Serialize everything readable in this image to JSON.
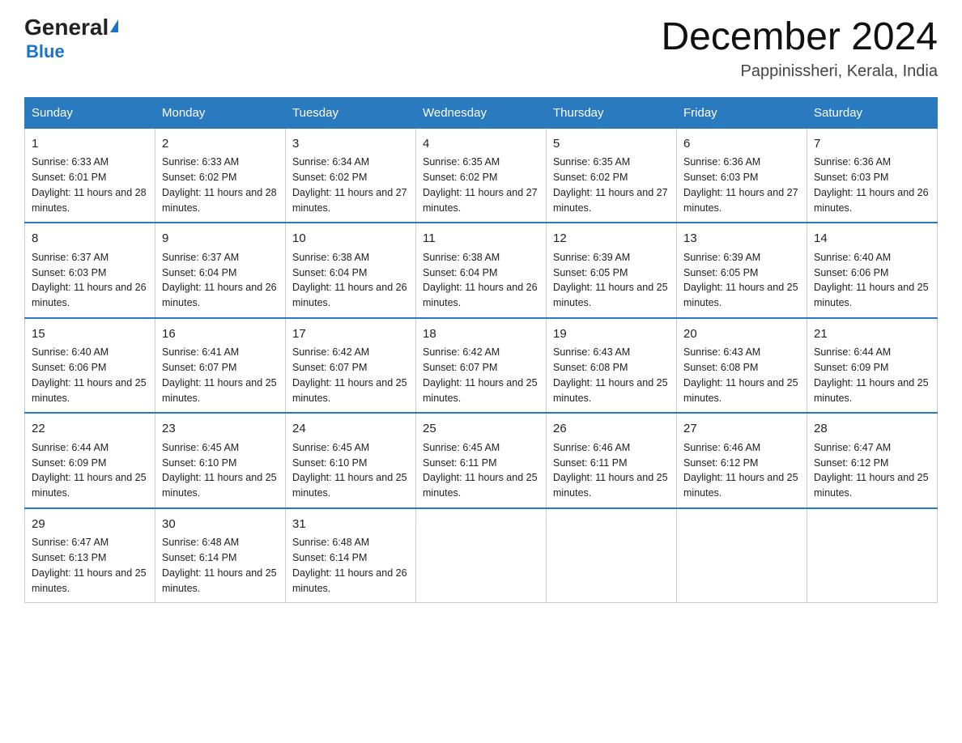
{
  "logo": {
    "general": "General",
    "blue": "Blue",
    "triangle_label": "logo-triangle"
  },
  "header": {
    "title": "December 2024",
    "subtitle": "Pappinissheri, Kerala, India"
  },
  "weekdays": [
    "Sunday",
    "Monday",
    "Tuesday",
    "Wednesday",
    "Thursday",
    "Friday",
    "Saturday"
  ],
  "weeks": [
    [
      {
        "day": "1",
        "sunrise": "6:33 AM",
        "sunset": "6:01 PM",
        "daylight": "11 hours and 28 minutes."
      },
      {
        "day": "2",
        "sunrise": "6:33 AM",
        "sunset": "6:02 PM",
        "daylight": "11 hours and 28 minutes."
      },
      {
        "day": "3",
        "sunrise": "6:34 AM",
        "sunset": "6:02 PM",
        "daylight": "11 hours and 27 minutes."
      },
      {
        "day": "4",
        "sunrise": "6:35 AM",
        "sunset": "6:02 PM",
        "daylight": "11 hours and 27 minutes."
      },
      {
        "day": "5",
        "sunrise": "6:35 AM",
        "sunset": "6:02 PM",
        "daylight": "11 hours and 27 minutes."
      },
      {
        "day": "6",
        "sunrise": "6:36 AM",
        "sunset": "6:03 PM",
        "daylight": "11 hours and 27 minutes."
      },
      {
        "day": "7",
        "sunrise": "6:36 AM",
        "sunset": "6:03 PM",
        "daylight": "11 hours and 26 minutes."
      }
    ],
    [
      {
        "day": "8",
        "sunrise": "6:37 AM",
        "sunset": "6:03 PM",
        "daylight": "11 hours and 26 minutes."
      },
      {
        "day": "9",
        "sunrise": "6:37 AM",
        "sunset": "6:04 PM",
        "daylight": "11 hours and 26 minutes."
      },
      {
        "day": "10",
        "sunrise": "6:38 AM",
        "sunset": "6:04 PM",
        "daylight": "11 hours and 26 minutes."
      },
      {
        "day": "11",
        "sunrise": "6:38 AM",
        "sunset": "6:04 PM",
        "daylight": "11 hours and 26 minutes."
      },
      {
        "day": "12",
        "sunrise": "6:39 AM",
        "sunset": "6:05 PM",
        "daylight": "11 hours and 25 minutes."
      },
      {
        "day": "13",
        "sunrise": "6:39 AM",
        "sunset": "6:05 PM",
        "daylight": "11 hours and 25 minutes."
      },
      {
        "day": "14",
        "sunrise": "6:40 AM",
        "sunset": "6:06 PM",
        "daylight": "11 hours and 25 minutes."
      }
    ],
    [
      {
        "day": "15",
        "sunrise": "6:40 AM",
        "sunset": "6:06 PM",
        "daylight": "11 hours and 25 minutes."
      },
      {
        "day": "16",
        "sunrise": "6:41 AM",
        "sunset": "6:07 PM",
        "daylight": "11 hours and 25 minutes."
      },
      {
        "day": "17",
        "sunrise": "6:42 AM",
        "sunset": "6:07 PM",
        "daylight": "11 hours and 25 minutes."
      },
      {
        "day": "18",
        "sunrise": "6:42 AM",
        "sunset": "6:07 PM",
        "daylight": "11 hours and 25 minutes."
      },
      {
        "day": "19",
        "sunrise": "6:43 AM",
        "sunset": "6:08 PM",
        "daylight": "11 hours and 25 minutes."
      },
      {
        "day": "20",
        "sunrise": "6:43 AM",
        "sunset": "6:08 PM",
        "daylight": "11 hours and 25 minutes."
      },
      {
        "day": "21",
        "sunrise": "6:44 AM",
        "sunset": "6:09 PM",
        "daylight": "11 hours and 25 minutes."
      }
    ],
    [
      {
        "day": "22",
        "sunrise": "6:44 AM",
        "sunset": "6:09 PM",
        "daylight": "11 hours and 25 minutes."
      },
      {
        "day": "23",
        "sunrise": "6:45 AM",
        "sunset": "6:10 PM",
        "daylight": "11 hours and 25 minutes."
      },
      {
        "day": "24",
        "sunrise": "6:45 AM",
        "sunset": "6:10 PM",
        "daylight": "11 hours and 25 minutes."
      },
      {
        "day": "25",
        "sunrise": "6:45 AM",
        "sunset": "6:11 PM",
        "daylight": "11 hours and 25 minutes."
      },
      {
        "day": "26",
        "sunrise": "6:46 AM",
        "sunset": "6:11 PM",
        "daylight": "11 hours and 25 minutes."
      },
      {
        "day": "27",
        "sunrise": "6:46 AM",
        "sunset": "6:12 PM",
        "daylight": "11 hours and 25 minutes."
      },
      {
        "day": "28",
        "sunrise": "6:47 AM",
        "sunset": "6:12 PM",
        "daylight": "11 hours and 25 minutes."
      }
    ],
    [
      {
        "day": "29",
        "sunrise": "6:47 AM",
        "sunset": "6:13 PM",
        "daylight": "11 hours and 25 minutes."
      },
      {
        "day": "30",
        "sunrise": "6:48 AM",
        "sunset": "6:14 PM",
        "daylight": "11 hours and 25 minutes."
      },
      {
        "day": "31",
        "sunrise": "6:48 AM",
        "sunset": "6:14 PM",
        "daylight": "11 hours and 26 minutes."
      },
      null,
      null,
      null,
      null
    ]
  ],
  "labels": {
    "sunrise": "Sunrise:",
    "sunset": "Sunset:",
    "daylight": "Daylight:"
  }
}
